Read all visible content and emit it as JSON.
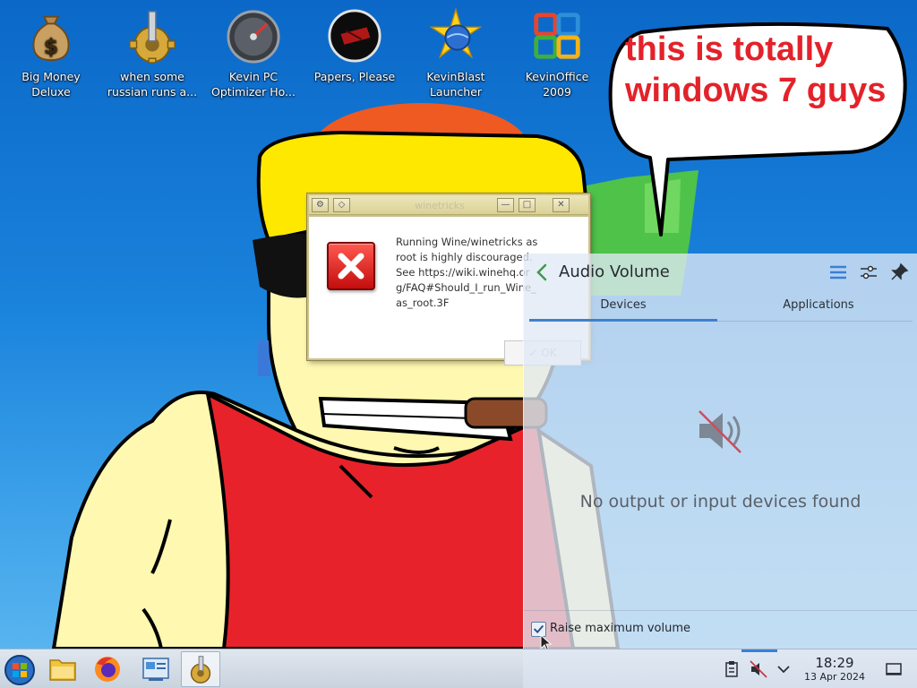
{
  "desktop": {
    "icons": [
      {
        "label": "Big Money\nDeluxe",
        "icon": "money-bag-icon"
      },
      {
        "label": "when some\nrussian runs a...",
        "icon": "gear-piston-icon"
      },
      {
        "label": "Kevin PC\nOptimizer Ho...",
        "icon": "speedometer-icon"
      },
      {
        "label": "Papers, Please",
        "icon": "papers-please-icon"
      },
      {
        "label": "KevinBlast\nLauncher",
        "icon": "star-globe-icon"
      },
      {
        "label": "KevinOffice\n2009",
        "icon": "office-logo-icon"
      }
    ]
  },
  "speech_bubble": {
    "text": "this is totally\nwindows 7 guys"
  },
  "wine_dialog": {
    "title": "winetricks",
    "message": "Running Wine/winetricks as root is highly discouraged. See https://wiki.winehq.org/FAQ#Should_I_run_Wine_as_root.3F",
    "ok_label": "OK",
    "icon": "error-x-icon"
  },
  "audio_panel": {
    "title": "Audio Volume",
    "tabs": [
      {
        "label": "Devices",
        "active": true
      },
      {
        "label": "Applications",
        "active": false
      }
    ],
    "empty_message": "No output or input devices found",
    "raise_max_volume": {
      "label": "Raise maximum volume",
      "checked": true
    }
  },
  "taskbar": {
    "items": [
      "start-orb-icon",
      "file-manager-icon",
      "firefox-icon",
      "control-panel-icon",
      "winetricks-icon"
    ],
    "tray": [
      "clipboard-icon",
      "volume-muted-icon",
      "expand-tray-icon"
    ],
    "clock": {
      "time": "18:29",
      "date": "13 Apr 2024"
    },
    "show_desktop": "show-desktop-icon"
  },
  "colors": {
    "accent": "#3b7fd4",
    "bubble_text": "#e3222a",
    "wallpaper": "#1a83dc",
    "error": "#d61b1b"
  }
}
